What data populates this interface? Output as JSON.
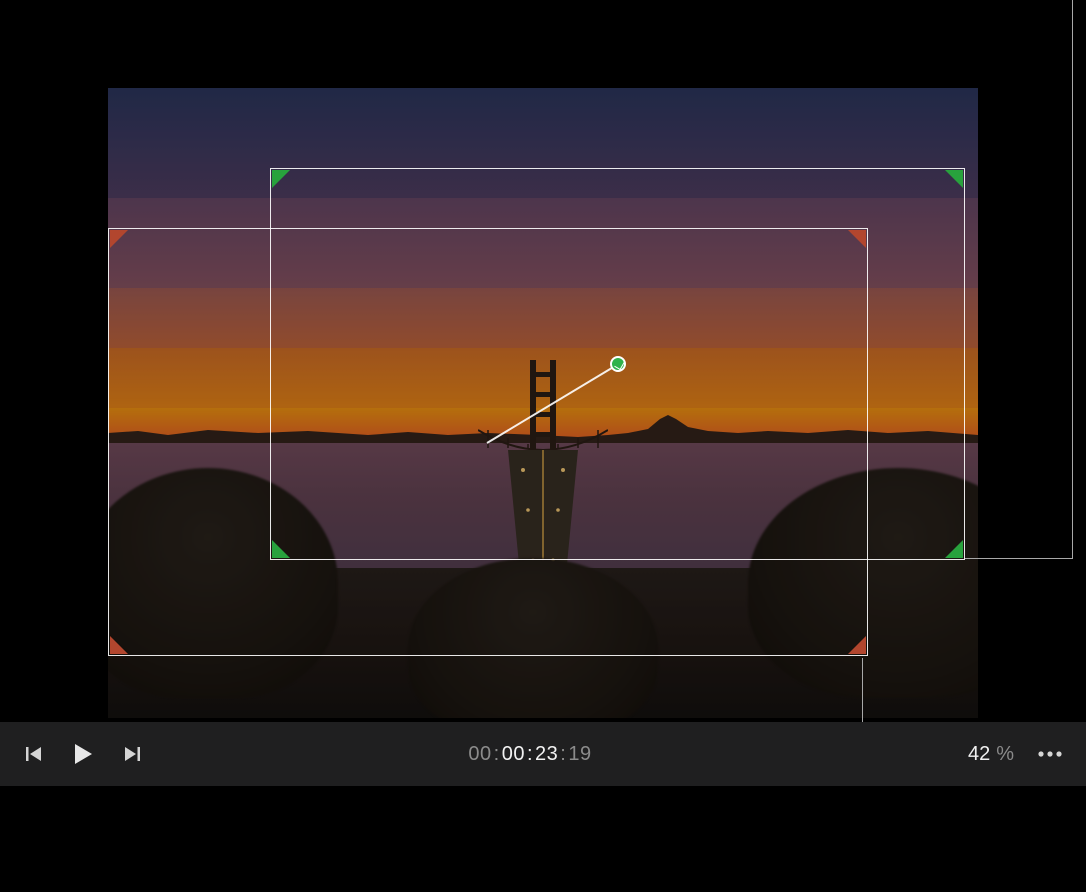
{
  "viewer": {
    "content_desc": "Sunset over bay bridge and city skyline"
  },
  "kenburns": {
    "start_color": "#b2462e",
    "end_color": "#28a23d",
    "arrow_icon": "motion-end-arrow"
  },
  "playback": {
    "prev_icon": "skip-back-icon",
    "play_icon": "play-icon",
    "next_icon": "skip-forward-icon",
    "more_icon": "more-icon",
    "timecode": {
      "hh": "00",
      "mm": "00",
      "ss": "23",
      "ff": "19",
      "sep": ":"
    },
    "zoom": {
      "value": "42",
      "unit": "%"
    }
  }
}
